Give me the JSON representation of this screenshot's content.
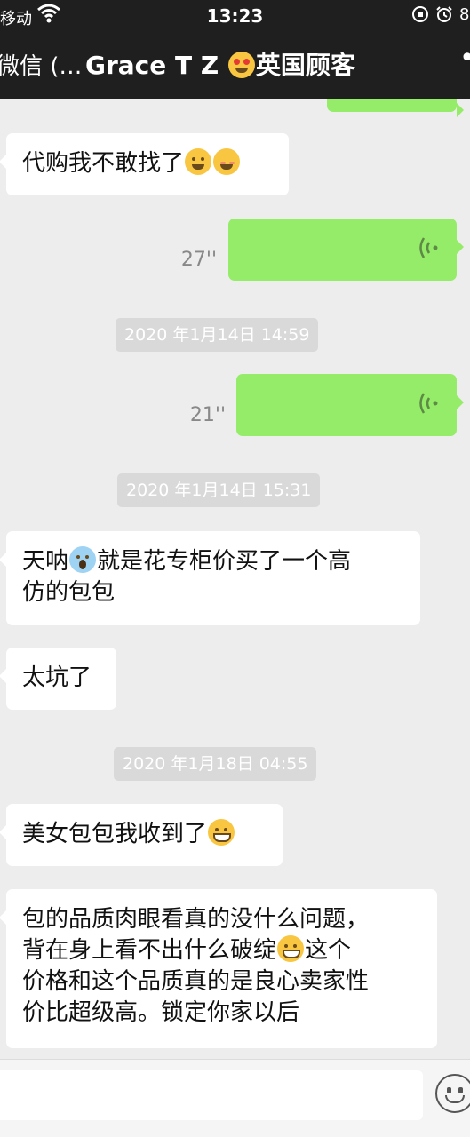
{
  "status_bar": {
    "carrier": "移动",
    "time": "13:23",
    "battery": "8"
  },
  "nav": {
    "back_label": "微信 (…",
    "title": "Grace T Z",
    "title_suffix": "英国顾客"
  },
  "messages": {
    "m1_text": "代购我不敢找了",
    "voice1_duration": "27''",
    "ts1": "2020 年1月14日 14:59",
    "voice2_duration": "21''",
    "ts2": "2020 年1月14日 15:31",
    "m2_prefix": "天呐",
    "m2_line1": "就是花专柜价买了一个高",
    "m2_line2": "仿的包包",
    "m3_text": "太坑了",
    "ts3": "2020 年1月18日 04:55",
    "m4_text": "美女包包我收到了",
    "m5_line1": "包的品质肉眼看真的没什么问题，",
    "m5_line2_a": "背在身上看不出什么破绽",
    "m5_line2_b": "这个",
    "m5_line3": "价格和这个品质真的是良心卖家性",
    "m5_line4": "价比超级高。锁定你家以后"
  },
  "colors": {
    "outgoing_bubble": "#95ec69",
    "incoming_bubble": "#ffffff",
    "background": "#ededed"
  }
}
